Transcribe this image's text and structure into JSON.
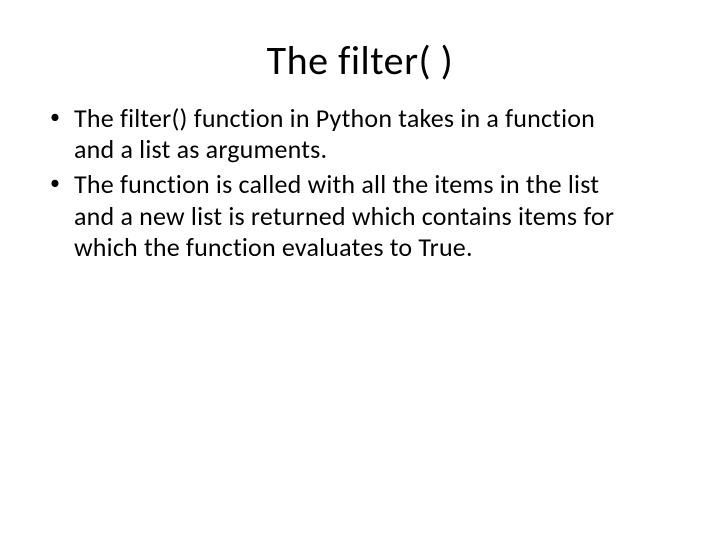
{
  "slide": {
    "title": "The filter( )",
    "bullets": [
      "The filter() function in Python takes in a  function and a list as arguments.",
      "The function is called with all the items in the  list and a new list is returned which contains  items for which the function evaluates to True."
    ]
  }
}
